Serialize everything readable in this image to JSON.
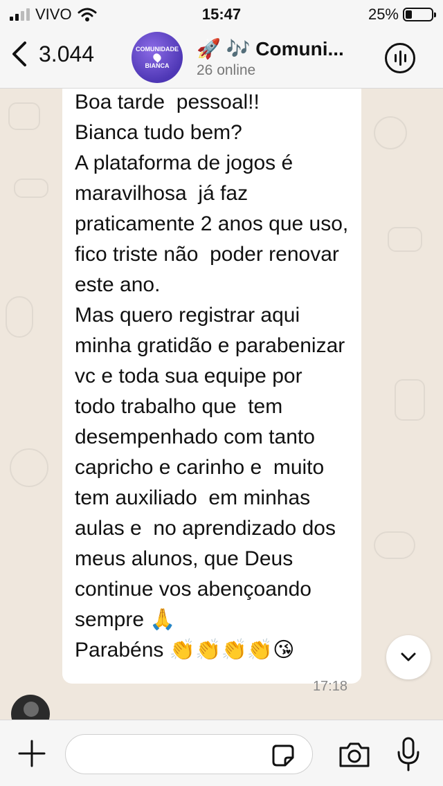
{
  "status_bar": {
    "carrier": "VIVO",
    "time": "15:47",
    "battery_percent": "25%",
    "battery_level": 0.25
  },
  "header": {
    "back_count": "3.044",
    "avatar_text_line1": "COMUNIDADE",
    "avatar_text_line2": "BIANCA",
    "group_title": "🚀 🎶 Comuni...",
    "subtitle": "26 online"
  },
  "message": {
    "text": "Boa tarde  pessoal!!\nBianca tudo bem?\nA plataforma de jogos é maravilhosa  já faz praticamente 2 anos que uso, fico triste não  poder renovar este ano.\nMas quero registrar aqui minha gratidão e parabenizar vc e toda sua equipe por  todo trabalho que  tem  desempenhado com tanto capricho e carinho e  muito  tem auxiliado  em minhas aulas e  no aprendizado dos meus alunos, que Deus continue vos abençoando sempre 🙏\nParabéns 👏👏👏👏😘",
    "time": "17:18"
  },
  "composer": {
    "placeholder": "",
    "value": ""
  },
  "icons": [
    "back-chevron-icon",
    "audio-call-icon",
    "chevron-down-icon",
    "plus-icon",
    "sticker-icon",
    "camera-icon",
    "microphone-icon",
    "wifi-icon",
    "battery-icon",
    "signal-icon"
  ],
  "colors": {
    "chat_background": "#efe7dd",
    "bubble": "#ffffff",
    "bars": "#f6f6f6",
    "avatar": "#5a3fc0"
  }
}
